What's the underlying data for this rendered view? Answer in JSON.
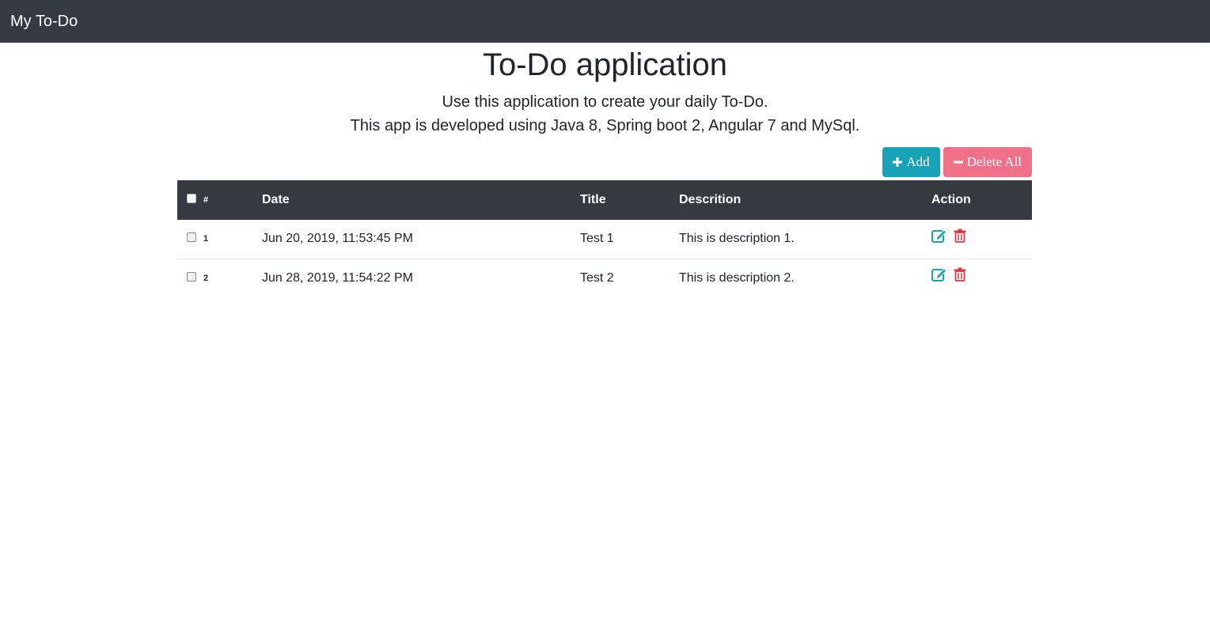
{
  "navbar": {
    "brand": "My To-Do"
  },
  "header": {
    "title": "To-Do application",
    "subtitle_1": "Use this application to create your daily To-Do.",
    "subtitle_2": "This app is developed using Java 8, Spring boot 2, Angular 7 and MySql."
  },
  "toolbar": {
    "add_label": "Add",
    "delete_all_label": "Delete All"
  },
  "colors": {
    "navbar_bg": "#343a40",
    "accent_info": "#17a2b8",
    "danger_light": "#f07088",
    "danger": "#dc3545"
  },
  "table": {
    "columns": [
      "#",
      "Date",
      "Title",
      "Descrition",
      "Action"
    ],
    "rows": [
      {
        "num": "1",
        "date": "Jun 20, 2019, 11:53:45 PM",
        "title": "Test 1",
        "description": "This is description 1.",
        "actions": [
          "edit-icon",
          "trash-icon"
        ]
      },
      {
        "num": "2",
        "date": "Jun 28, 2019, 11:54:22 PM",
        "title": "Test 2",
        "description": "This is description 2.",
        "actions": [
          "edit-icon",
          "trash-icon"
        ]
      }
    ]
  }
}
